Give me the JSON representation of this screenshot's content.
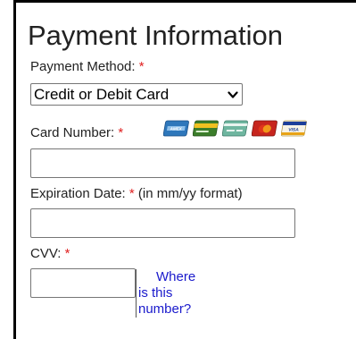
{
  "section": {
    "title": "Payment Information"
  },
  "payment_method": {
    "label": "Payment Method:",
    "required_mark": "*",
    "selected": "Credit or Debit Card"
  },
  "card_number": {
    "label": "Card Number:",
    "required_mark": "*",
    "value": "",
    "accepted_cards": [
      "amex-card-icon",
      "discover-card-icon",
      "generic-card-icon",
      "mastercard-card-icon",
      "visa-card-icon"
    ]
  },
  "expiration": {
    "label": "Expiration Date:",
    "required_mark": "*",
    "format_hint": "(in mm/yy format)",
    "value": ""
  },
  "cvv": {
    "label": "CVV:",
    "required_mark": "*",
    "value": "",
    "help_link": {
      "line1": "Where",
      "line2": "is this",
      "line3": "number?"
    }
  },
  "colors": {
    "required": "#e02020",
    "link": "#1a1acc",
    "text": "#222222"
  }
}
